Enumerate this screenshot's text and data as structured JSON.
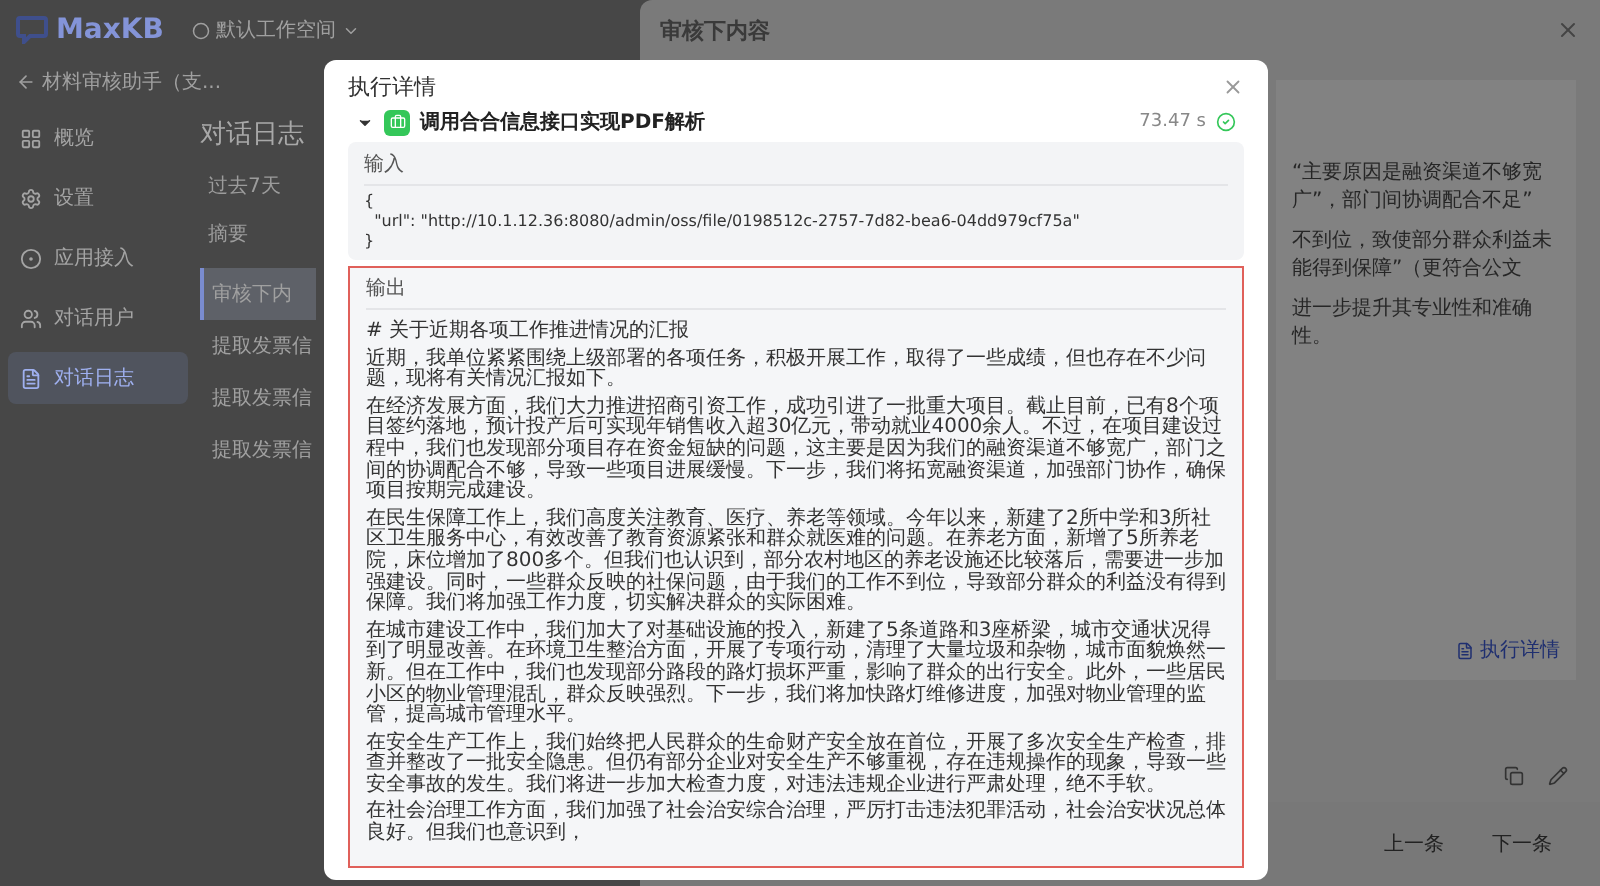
{
  "app": {
    "logo": "MaxKB",
    "workspace": "默认工作空间",
    "app_name": "材料审核助手（支...",
    "nav": [
      {
        "label": "概览",
        "selected": false
      },
      {
        "label": "设置",
        "selected": false
      },
      {
        "label": "应用接入",
        "selected": false
      },
      {
        "label": "对话用户",
        "selected": false
      },
      {
        "label": "对话日志",
        "selected": true
      }
    ],
    "page_title": "对话日志",
    "filter": "过去7天",
    "table": {
      "columns": [
        "摘要"
      ],
      "rows": [
        {
          "cells": [
            "审核下内"
          ],
          "selected": true
        },
        {
          "cells": [
            "提取发票信"
          ],
          "selected": false
        },
        {
          "cells": [
            "提取发票信"
          ],
          "selected": false
        },
        {
          "cells": [
            "提取发票信"
          ],
          "selected": false
        }
      ]
    }
  },
  "drawer": {
    "title": "审核下内容",
    "text_lines": [
      "“主要原因是融资渠道不够宽广”，部门间协调配合不足”",
      "不到位，致使部分群众利益未能得到保障”（更符合公文",
      "进一步提升其专业性和准确性。"
    ],
    "details_link": "执行详情",
    "prev": "上一条",
    "next": "下一条"
  },
  "modal": {
    "title": "执行详情",
    "step": {
      "title": "调用合合信息接口实现PDF解析",
      "duration": "73.47 s",
      "expanded": true,
      "input": {
        "label": "输入",
        "lines": [
          "{",
          "  \"url\": \"http://10.1.12.36:8080/admin/oss/file/0198512c-2757-7d82-bea6-04dd979cf75a\"",
          "}"
        ]
      },
      "output": {
        "label": "输出",
        "paragraphs": [
          "# 关于近期各项工作推进情况的汇报",
          "近期，我单位紧紧围绕上级部署的各项任务，积极开展工作，取得了一些成绩，但也存在不少问题，现将有关情况汇报如下。",
          "在经济发展方面，我们大力推进招商引资工作，成功引进了一批重大项目。截止目前，已有8个项目签约落地，预计投产后可实现年销售收入超30亿元，带动就业4000余人。不过，在项目建设过程中，我们也发现部分项目存在资金短缺的问题，这主要是因为我们的融资渠道不够宽广，部门之间的协调配合不够，导致一些项目进展缓慢。下一步，我们将拓宽融资渠道，加强部门协作，确保项目按期完成建设。",
          "在民生保障工作上，我们高度关注教育、医疗、养老等领域。今年以来，新建了2所中学和3所社区卫生服务中心，有效改善了教育资源紧张和群众就医难的问题。在养老方面，新增了5所养老院，床位增加了800多个。但我们也认识到，部分农村地区的养老设施还比较落后，需要进一步加强建设。同时，一些群众反映的社保问题，由于我们的工作不到位，导致部分群众的利益没有得到保障。我们将加强工作力度，切实解决群众的实际困难。",
          "在城市建设工作中，我们加大了对基础设施的投入，新建了5条道路和3座桥梁，城市交通状况得到了明显改善。在环境卫生整治方面，开展了专项行动，清理了大量垃圾和杂物，城市面貌焕然一新。但在工作中，我们也发现部分路段的路灯损坏严重，影响了群众的出行安全。此外，一些居民小区的物业管理混乱，群众反映强烈。下一步，我们将加快路灯维修进度，加强对物业管理的监管，提高城市管理水平。",
          "在安全生产工作上，我们始终把人民群众的生命财产安全放在首位，开展了多次安全生产检查，排查并整改了一批安全隐患。但仍有部分企业对安全生产不够重视，存在违规操作的现象，导致一些安全事故的发生。我们将进一步加大检查力度，对违法违规企业进行严肃处理，绝不手软。",
          "在社会治理工作方面，我们加强了社会治安综合治理，严厉打击违法犯罪活动，社会治安状况总体良好。但我们也意识到，"
        ]
      }
    }
  }
}
